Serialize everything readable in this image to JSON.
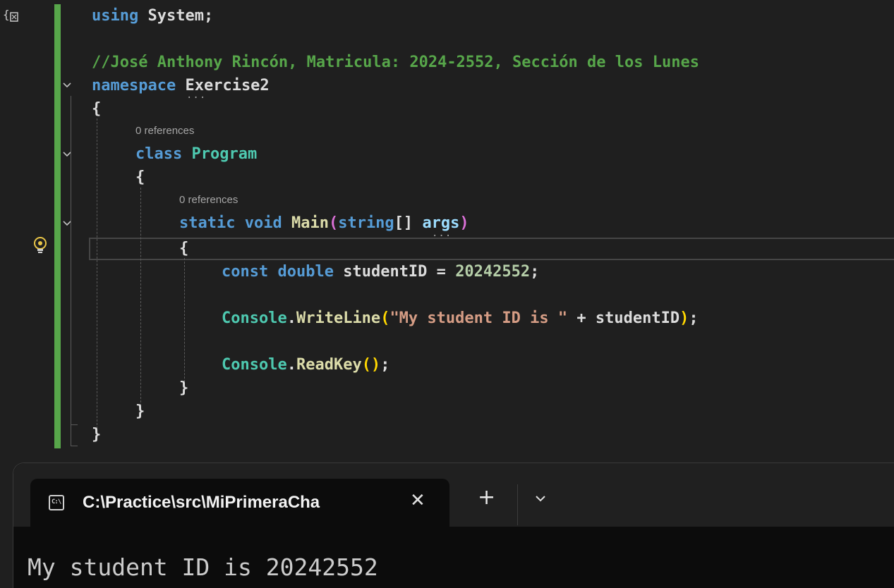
{
  "editor": {
    "lines": {
      "using_kw": "using",
      "using_ns": "System",
      "semicolon": ";",
      "comment": "//José Anthony Rincón, Matricula: 2024-2552, Sección de los Lunes",
      "namespace_kw": "namespace",
      "namespace_name": "Exercise2",
      "open_brace": "{",
      "close_brace": "}",
      "class_kw": "class",
      "class_name": "Program",
      "static_kw": "static",
      "void_kw": "void",
      "main_name": "Main",
      "string_kw": "string",
      "array_brackets": "[]",
      "args_name": "args",
      "const_kw": "const",
      "double_kw": "double",
      "student_id_var": "studentID",
      "assign": " = ",
      "student_id_value": "20242552",
      "console": "Console",
      "dot": ".",
      "writeline": "WriteLine",
      "string_literal": "\"My student ID is \"",
      "plus": " + ",
      "readkey": "ReadKey",
      "empty_parens": "()"
    },
    "codelens": {
      "class_refs": "0 references",
      "main_refs": "0 references"
    },
    "icons": {
      "top_glyph": "code-glyph-icon",
      "bulb": "lightbulb-icon",
      "fold": "chevron-down-icon"
    },
    "colors": {
      "keyword": "#569cd6",
      "type": "#4ec9b0",
      "method": "#dcdcaa",
      "comment": "#57a64a",
      "string": "#d69d85",
      "number": "#b5cea8",
      "change_bar": "#57a64a"
    }
  },
  "terminal": {
    "tab_title": "C:\\Practice\\src\\MiPrimeraCha",
    "tab_icon_text": "C:\\",
    "close_glyph": "✕",
    "new_tab_glyph": "+",
    "output": "My student ID is 20242552"
  }
}
